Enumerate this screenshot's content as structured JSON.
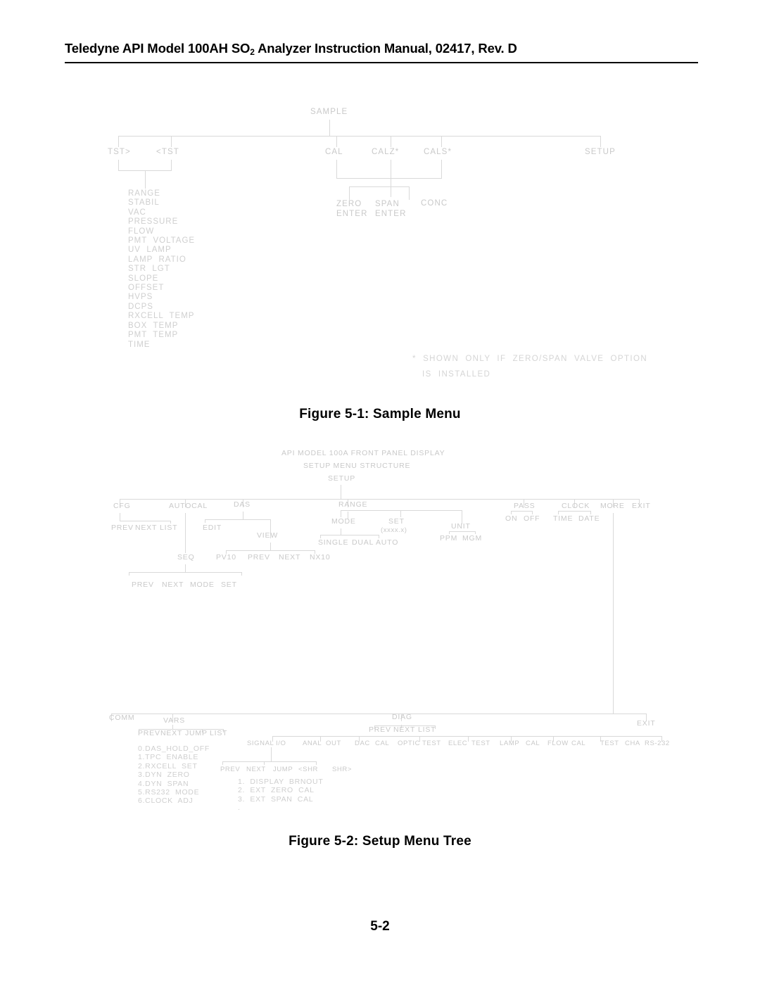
{
  "header": {
    "title_pre": "Teledyne API Model 100AH SO",
    "title_sub": "2",
    "title_post": " Analyzer Instruction Manual, 02417, Rev. D"
  },
  "figure1": {
    "caption": "Figure 5-1:  Sample Menu",
    "root": "SAMPLE",
    "nodes": {
      "tst_right": "TST>",
      "tst_left": "<TST",
      "cal": "CAL",
      "calz": "CALZ*",
      "cals": "CALS*",
      "setup": "SETUP",
      "zero": "ZERO",
      "zero_enter": "ENTER",
      "span": "SPAN",
      "span_enter": "ENTER",
      "conc": "CONC"
    },
    "test_functions": [
      "RANGE",
      "STABIL",
      "VAC",
      "PRESSURE",
      "FLOW",
      "PMT  VOLTAGE",
      "UV  LAMP",
      "LAMP  RATIO",
      "STR  LGT",
      "SLOPE",
      "OFFSET",
      "HVPS",
      "DCPS",
      "RXCELL  TEMP",
      "BOX  TEMP",
      "PMT  TEMP",
      "TIME"
    ],
    "footnote_line1": "*  SHOWN  ONLY  IF  ZERO/SPAN  VALVE  OPTION",
    "footnote_line2": "IS  INSTALLED"
  },
  "figure2": {
    "caption": "Figure 5-2:  Setup Menu Tree",
    "title_line1": "API  MODEL  100A  FRONT  PANEL  DISPLAY",
    "title_line2": "SETUP  MENU  STRUCTURE",
    "root": "SETUP",
    "nodes": {
      "cfg": "CFG",
      "cfg_prev": "PREV",
      "cfg_next": "NEXT",
      "cfg_list": "LIST",
      "autocal": "AUTOCAL",
      "seq": "SEQ",
      "seq_prev": "PREV",
      "seq_next": "NEXT",
      "seq_mode": "MODE",
      "seq_set": "SET",
      "das": "DAS",
      "das_edit": "EDIT",
      "das_view": "VIEW",
      "view_pv10": "PV10",
      "view_prev": "PREV",
      "view_next": "NEXT",
      "view_nx10": "NX10",
      "range": "RANGE",
      "range_mode": "MODE",
      "range_set": "SET",
      "range_set_value": "(xxxx.x)",
      "mode_single": "SINGLE",
      "mode_dual": "DUAL",
      "mode_auto": "AUTO",
      "unit": "UNIT",
      "unit_ppm": "PPM",
      "unit_mgm": "MGM",
      "pass": "PASS",
      "pass_on": "ON",
      "pass_off": "OFF",
      "clock": "CLOCK",
      "clock_time": "TIME",
      "clock_date": "DATE",
      "more": "MORE",
      "exit_top": "EXIT",
      "comm": "COMM",
      "vars": "VARS",
      "vars_prev": "PREV",
      "vars_next": "NEXT",
      "vars_jump": "JUMP",
      "vars_list": "LIST",
      "diag": "DIAG",
      "diag_prev": "PREV",
      "diag_next": "NEXT",
      "diag_list": "LIST",
      "exit_bottom": "EXIT",
      "sig_prev": "PREV",
      "sig_next": "NEXT",
      "sig_jump": "JUMP",
      "sig_shr_left": "<SHR",
      "sig_shr_right": "SHR>"
    },
    "vars_items": [
      "0.DAS_HOLD_OFF",
      "1.TPC  ENABLE",
      "2.RXCELL  SET",
      "3.DYN  ZERO",
      "4.DYN  SPAN",
      "5.RS232  MODE",
      "6.CLOCK  ADJ"
    ],
    "diag_items": [
      "SIGNAL",
      "I/O",
      "ANAL",
      "OUT",
      "DAC",
      "CAL",
      "OPTIC",
      "TEST",
      "ELEC",
      "TEST",
      "LAMP",
      "CAL",
      "FLOW",
      "CAL",
      "TEST",
      "CHA",
      "RS-232"
    ],
    "signal_io_items": [
      "1.  DISPLAY  BRNOUT",
      "2.  EXT  ZERO  CAL",
      "3.  EXT  SPAN  CAL",
      "."
    ]
  },
  "page_number": "5-2",
  "colors": {
    "text": "#000000",
    "diagram_line": "#d9d9d9",
    "diagram_text": "#c9c9c9"
  }
}
